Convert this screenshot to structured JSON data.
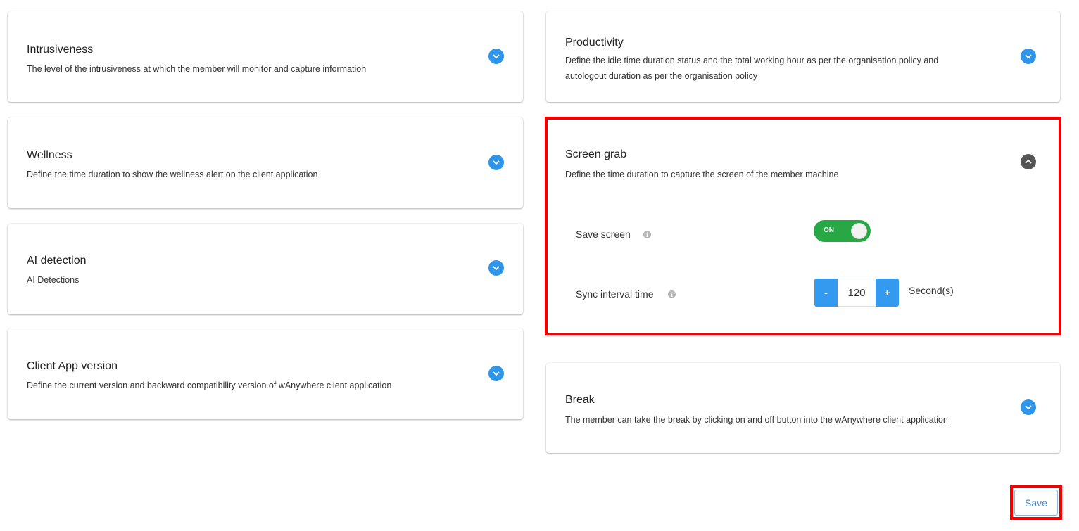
{
  "sections": {
    "intrusiveness": {
      "title": "Intrusiveness",
      "description": "The level of the intrusiveness at which the member will monitor and capture information",
      "icon": "chevron-down-icon",
      "expanded": false
    },
    "wellness": {
      "title": "Wellness",
      "description": "Define the time duration to show the wellness alert on the client application",
      "icon": "chevron-down-icon",
      "expanded": false
    },
    "ai_detection": {
      "title": "AI detection",
      "description": "AI Detections",
      "icon": "chevron-down-icon",
      "expanded": false
    },
    "client_app_version": {
      "title": "Client App version",
      "description": "Define the current version and backward compatibility version of wAnywhere client application",
      "icon": "chevron-down-icon",
      "expanded": false
    },
    "productivity": {
      "title": "Productivity",
      "description_line1": "Define the idle time duration status and the total working hour as per the organisation policy and",
      "description_line2": "autologout duration as per the organisation policy",
      "icon": "chevron-down-icon",
      "expanded": false
    },
    "screen_grab": {
      "title": "Screen grab",
      "description": "Define the time duration to capture the screen of the member machine",
      "icon": "chevron-up-icon",
      "expanded": true,
      "save_screen": {
        "label": "Save screen",
        "info_icon": "info-icon",
        "toggle_state": "ON"
      },
      "sync_interval": {
        "label": "Sync interval time",
        "info_icon": "info-icon",
        "minus_label": "-",
        "value": "120",
        "plus_label": "+",
        "unit": "Second(s)"
      }
    },
    "break": {
      "title": "Break",
      "description": "The member can take the break by clicking on and off button into the wAnywhere client application",
      "icon": "chevron-down-icon",
      "expanded": false
    }
  },
  "actions": {
    "save_label": "Save"
  },
  "colors": {
    "accent_blue": "#2f95ea",
    "toggle_on_green": "#28a745",
    "highlight_red": "#f40000",
    "collapse_icon_dark": "#555555"
  }
}
